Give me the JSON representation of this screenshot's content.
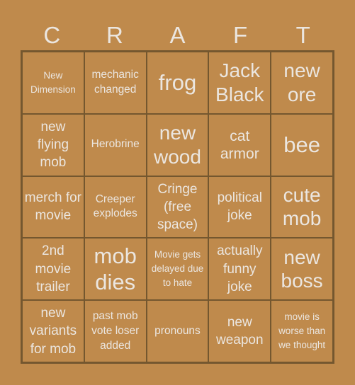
{
  "title_letters": [
    "C",
    "R",
    "A",
    "F",
    "T"
  ],
  "colors": {
    "background": "#bf8a4c",
    "border": "#74572f",
    "text": "#ebe6e0"
  },
  "cells": [
    [
      "New Dimension",
      "mechanic changed",
      "frog",
      "Jack Black",
      "new ore"
    ],
    [
      "new flying mob",
      "Herobrine",
      "new wood",
      "cat armor",
      "bee"
    ],
    [
      "merch for movie",
      "Creeper explodes",
      "Cringe (free space)",
      "political joke",
      "cute mob"
    ],
    [
      "2nd movie trailer",
      "mob dies",
      "Movie gets delayed due to hate",
      "actually funny joke",
      "new boss"
    ],
    [
      "new variants for mob",
      "past mob vote loser added",
      "pronouns",
      "new weapon",
      "movie is worse than we thought"
    ]
  ],
  "free_space": "Cringe (free space)"
}
